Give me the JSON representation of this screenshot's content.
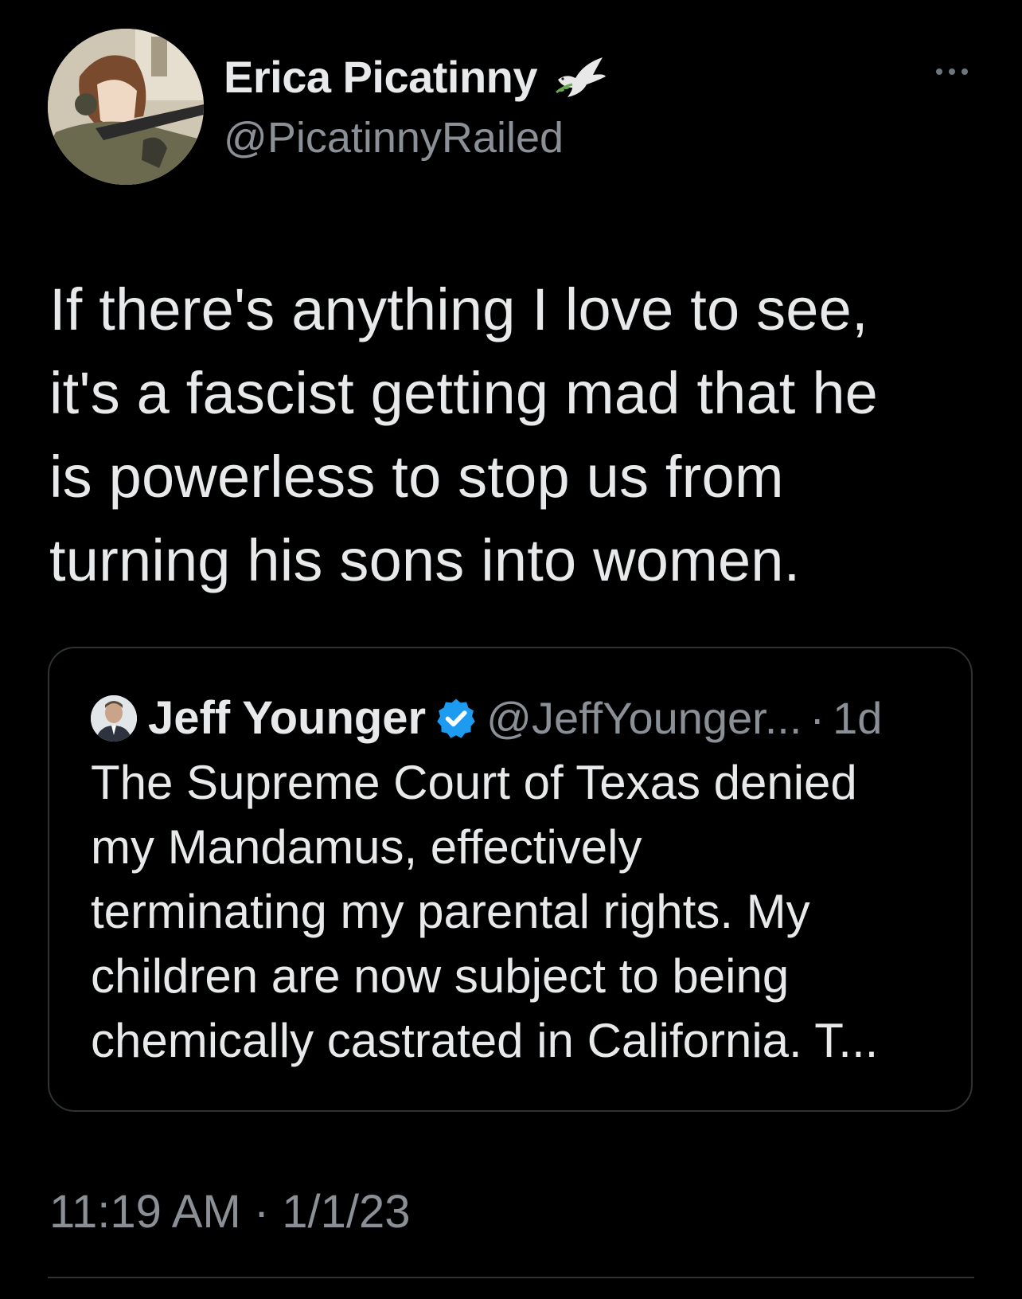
{
  "author": {
    "display_name": "Erica Picatinny",
    "handle": "@PicatinnyRailed",
    "badge_icon": "dove-icon",
    "avatar_icon": "anime-soldier-avatar"
  },
  "tweet": {
    "text": "If there's anything I love to see,\nit's a fascist getting mad that he\nis powerless to stop us from\nturning his sons into women.",
    "timestamp": "11:19 AM · 1/1/23"
  },
  "quoted_tweet": {
    "display_name": "Jeff Younger",
    "verified_icon": "verified-badge-icon",
    "handle": "@JeffYounger...",
    "separator": "·",
    "time": "1d",
    "text": "The Supreme Court of Texas denied\nmy Mandamus, effectively\nterminating my parental rights. My\nchildren are now subject to being\nchemically castrated in California. T..."
  },
  "menu": {
    "icon": "more-options-icon"
  },
  "colors": {
    "background": "#000000",
    "primary_text": "#e7e9ea",
    "secondary_text": "#8b9096",
    "border": "#2f3336",
    "verified": "#1d9bf0"
  }
}
